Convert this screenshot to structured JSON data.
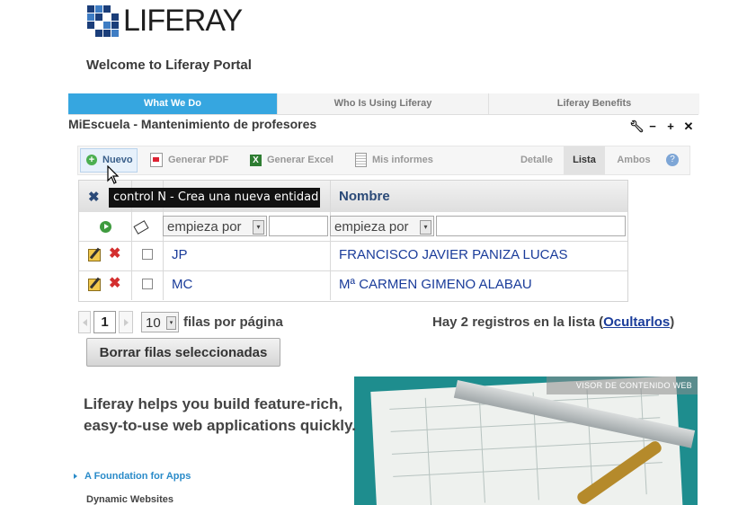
{
  "logo": {
    "text": "LIFERAY"
  },
  "welcome": "Welcome to Liferay Portal",
  "nav": {
    "tabs": [
      {
        "label": "What We Do",
        "active": true
      },
      {
        "label": "Who Is Using Liferay",
        "active": false
      },
      {
        "label": "Liferay Benefits",
        "active": false
      }
    ]
  },
  "portlet": {
    "title": "MiEscuela - Mantenimiento de profesores",
    "controls": [
      "wrench-icon",
      "minimize-icon",
      "maximize-icon",
      "close-icon"
    ]
  },
  "toolbar": {
    "nuevo": "Nuevo",
    "pdf": "Generar PDF",
    "excel": "Generar Excel",
    "informes": "Mis informes",
    "views": [
      "Detalle",
      "Lista",
      "Ambos"
    ],
    "selected_view": "Lista"
  },
  "tooltip": "control N - Crea una nueva entidad",
  "grid": {
    "column_header": "Nombre",
    "filter_placeholder": "empieza por",
    "rows": [
      {
        "code": "JP",
        "name": "FRANCISCO JAVIER PANIZA LUCAS"
      },
      {
        "code": "MC",
        "name": "Mª CARMEN GIMENO ALABAU"
      }
    ]
  },
  "pager": {
    "current_page": "1",
    "page_size": "10",
    "per_page_label": "filas por página"
  },
  "count": {
    "text": "Hay 2 registros en la lista (",
    "link": "Ocultarlos",
    "close": ")"
  },
  "delete_button": "Borrar filas seleccionadas",
  "banner": {
    "visor": "VISOR DE CONTENIDO WEB",
    "tagline_1": "Liferay helps you build feature-rich,",
    "tagline_2": "easy-to-use web applications quickly.",
    "link": "A Foundation for Apps",
    "sub": "Dynamic Websites"
  },
  "colors": {
    "accent": "#36a6e0",
    "link": "#1a3c9a",
    "header_text": "#2b4a78"
  }
}
